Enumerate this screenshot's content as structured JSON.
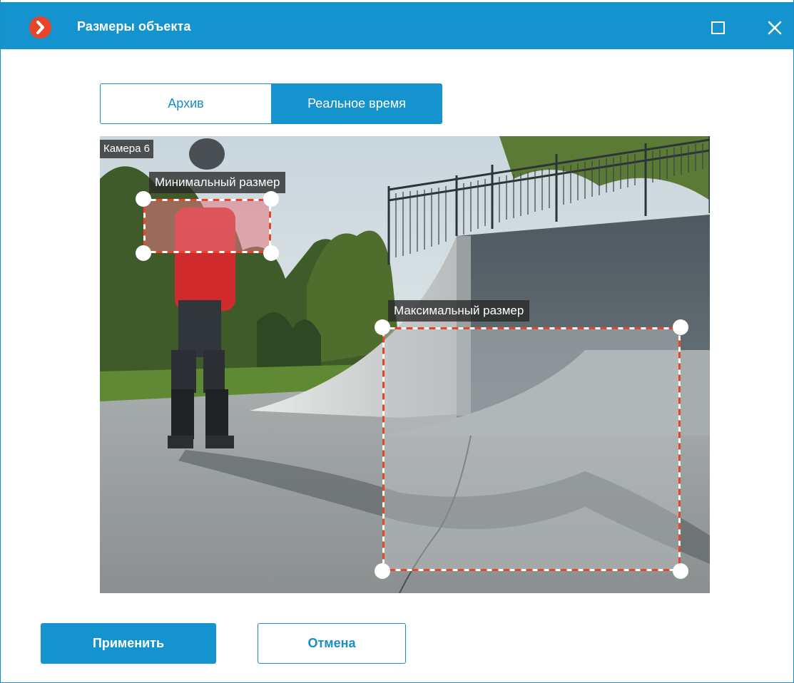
{
  "window": {
    "title": "Размеры объекта",
    "logo_icon": "chevron-right-circle-icon",
    "maximize_icon": "maximize-icon",
    "close_icon": "close-icon"
  },
  "mode_toggle": {
    "options": [
      {
        "label": "Архив",
        "selected": false
      },
      {
        "label": "Реальное время",
        "selected": true
      }
    ]
  },
  "video": {
    "camera_label": "Камера 6",
    "zones": {
      "min": {
        "label": "Минимальный размер"
      },
      "max": {
        "label": "Максимальный размер"
      }
    }
  },
  "actions": {
    "apply_label": "Применить",
    "cancel_label": "Отмена"
  },
  "colors": {
    "accent": "#1593cf",
    "logo": "#e8442a",
    "zone_border_red": "#e8442a",
    "zone_border_white": "#ffffff"
  }
}
